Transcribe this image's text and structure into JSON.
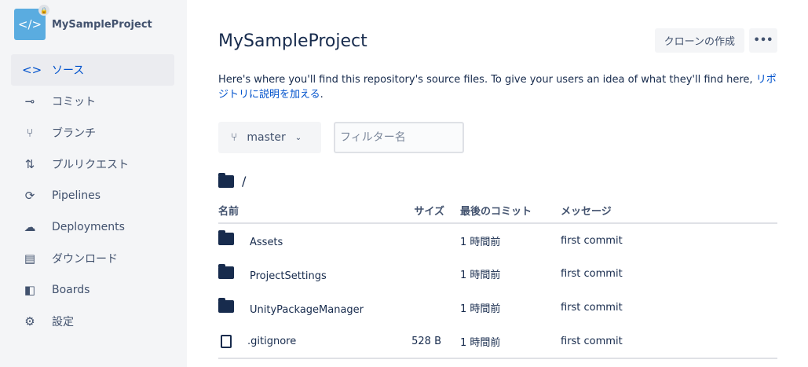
{
  "sidebar": {
    "project_name": "MySampleProject",
    "items": [
      {
        "label": "ソース",
        "icon": "code-icon",
        "glyph": "<>"
      },
      {
        "label": "コミット",
        "icon": "commit-icon",
        "glyph": "⊸"
      },
      {
        "label": "ブランチ",
        "icon": "branch-icon",
        "glyph": "⑂"
      },
      {
        "label": "プルリクエスト",
        "icon": "pull-request-icon",
        "glyph": "⇅"
      },
      {
        "label": "Pipelines",
        "icon": "pipelines-icon",
        "glyph": "⟳"
      },
      {
        "label": "Deployments",
        "icon": "cloud-upload-icon",
        "glyph": "☁"
      },
      {
        "label": "ダウンロード",
        "icon": "download-file-icon",
        "glyph": "▤"
      },
      {
        "label": "Boards",
        "icon": "boards-icon",
        "glyph": "◧"
      },
      {
        "label": "設定",
        "icon": "gear-icon",
        "glyph": "⚙"
      }
    ]
  },
  "header": {
    "title": "MySampleProject",
    "clone_label": "クローンの作成",
    "more_label": "•••"
  },
  "description": {
    "text": "Here's where you'll find this repository's source files. To give your users an idea of what they'll find here, ",
    "link": "リポジトリに説明を加える",
    "end": "."
  },
  "branch": {
    "name": "master"
  },
  "filter": {
    "placeholder": "フィルター名",
    "value": ""
  },
  "path": "/",
  "table": {
    "headers": [
      "名前",
      "サイズ",
      "最後のコミット",
      "メッセージ"
    ],
    "rows": [
      {
        "type": "folder",
        "name": "Assets",
        "size": "",
        "commit": "1 時間前",
        "message": "first commit"
      },
      {
        "type": "folder",
        "name": "ProjectSettings",
        "size": "",
        "commit": "1 時間前",
        "message": "first commit"
      },
      {
        "type": "folder",
        "name": "UnityPackageManager",
        "size": "",
        "commit": "1 時間前",
        "message": "first commit"
      },
      {
        "type": "file",
        "name": ".gitignore",
        "size": "528 B",
        "commit": "1 時間前",
        "message": "first commit"
      }
    ]
  }
}
